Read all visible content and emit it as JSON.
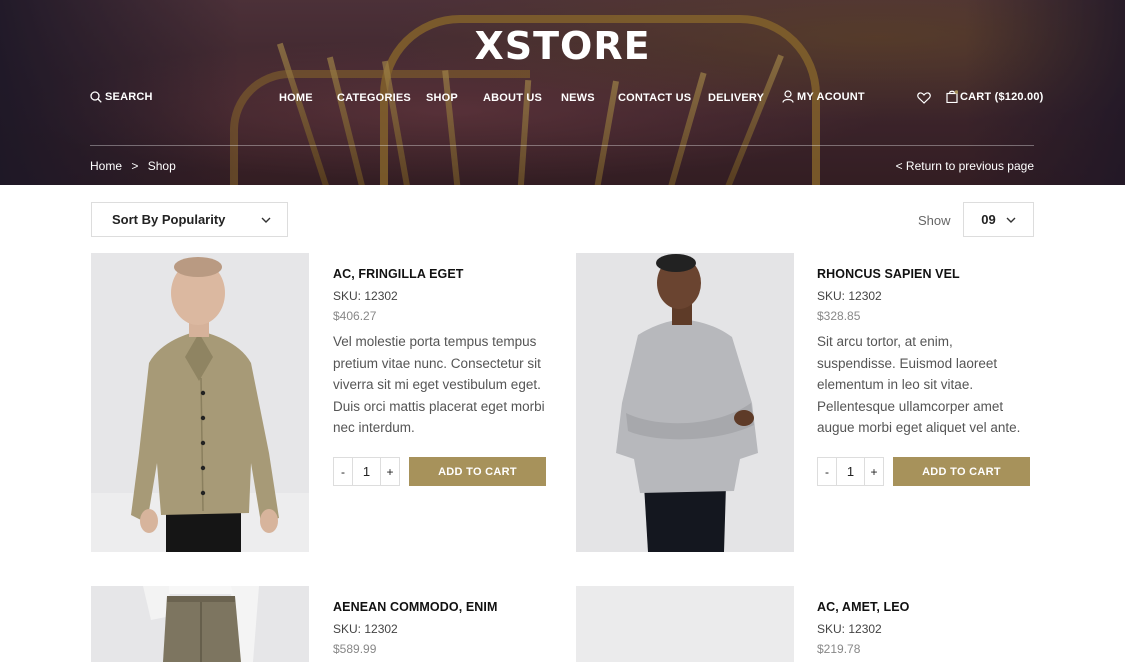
{
  "header": {
    "logo": "XSTORE",
    "search_label": "SEARCH",
    "nav_items": [
      "HOME",
      "CATEGORIES",
      "SHOP",
      "ABOUT US",
      "NEWS",
      "CONTACT US",
      "DELIVERY"
    ],
    "account_label": "MY ACOUNT",
    "cart_label": "CART ($120.00)"
  },
  "breadcrumb": {
    "home": "Home",
    "separator": ">",
    "current": "Shop",
    "return_label": "< Return to previous page"
  },
  "toolbar": {
    "sort_selected": "Sort By Popularity",
    "show_label": "Show",
    "show_value": "09"
  },
  "products": [
    {
      "title": "AC, FRINGILLA EGET",
      "sku": "SKU: 12302",
      "price": "$406.27",
      "desc": "Vel molestie porta tempus tempus pretium vitae nunc. Consectetur sit viverra sit mi eget vestibulum eget. Duis orci mattis placerat eget morbi nec interdum.",
      "qty": "1",
      "cart_label": "ADD TO CART"
    },
    {
      "title": "RHONCUS SAPIEN VEL",
      "sku": "SKU: 12302",
      "price": "$328.85",
      "desc": "Sit arcu tortor, at enim, suspendisse. Euismod laoreet elementum in leo sit vitae. Pellentesque ullamcorper amet augue morbi eget aliquet vel ante.",
      "qty": "1",
      "cart_label": "ADD TO CART"
    },
    {
      "title": "AENEAN COMMODO, ENIM",
      "sku": "SKU: 12302",
      "price": "$589.99"
    },
    {
      "title": "AC, AMET, LEO",
      "sku": "SKU: 12302",
      "price": "$219.78"
    }
  ],
  "qty_controls": {
    "minus": "-",
    "plus": "+"
  },
  "colors": {
    "accent": "#a7925b",
    "hero_bg": "#4a2f37"
  },
  "icons": [
    "search-icon",
    "user-icon",
    "heart-icon",
    "shopping-bag-icon",
    "chevron-down-icon"
  ]
}
